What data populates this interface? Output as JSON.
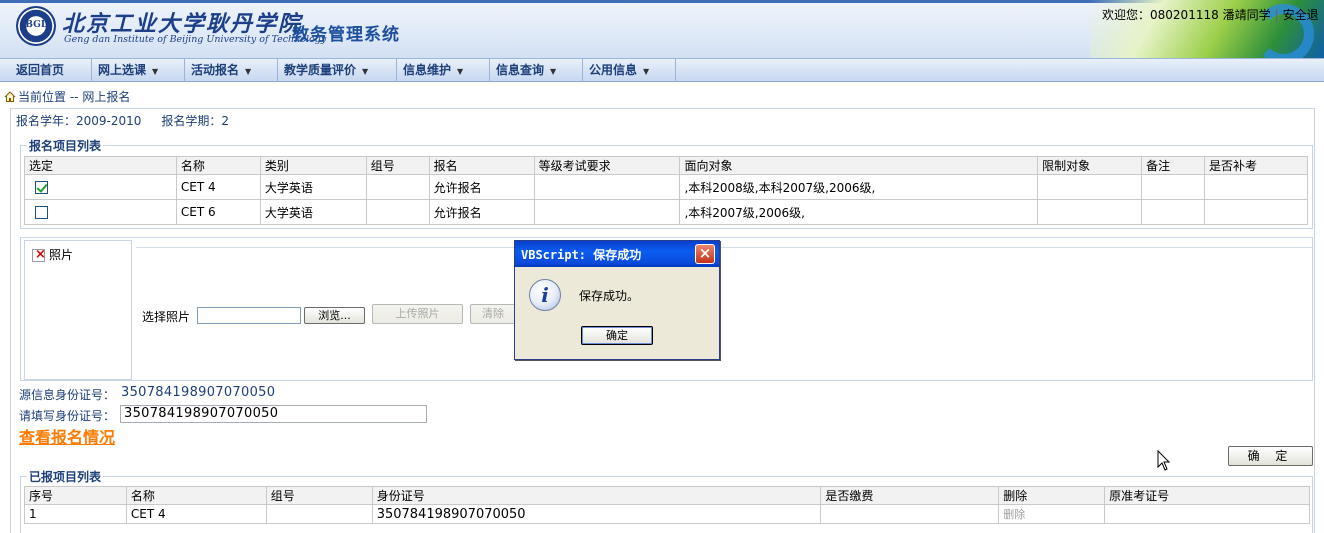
{
  "header": {
    "emblem_text": "BGD",
    "school_name_cn": "北京工业大学耿丹学院",
    "school_name_en": "Geng dan Institute of Beijing University of Technology",
    "system_title": "教务管理系统",
    "welcome_prefix": "欢迎您：",
    "user_id": "080201118",
    "user_name": "潘靖同学",
    "safe_exit": "安全退"
  },
  "nav": {
    "items": [
      {
        "label": "返回首页",
        "has_menu": false
      },
      {
        "label": "网上选课",
        "has_menu": true
      },
      {
        "label": "活动报名",
        "has_menu": true
      },
      {
        "label": "教学质量评价",
        "has_menu": true
      },
      {
        "label": "信息维护",
        "has_menu": true
      },
      {
        "label": "信息查询",
        "has_menu": true
      },
      {
        "label": "公用信息",
        "has_menu": true
      }
    ]
  },
  "breadcrumb": {
    "prefix": "当前位置",
    "path": "-- 网上报名"
  },
  "term": {
    "year": "报名学年：2009-2010",
    "semester": "报名学期：2"
  },
  "project_list": {
    "legend": "报名项目列表",
    "columns": [
      "选定",
      "名称",
      "类别",
      "组号",
      "报名",
      "等级考试要求",
      "面向对象",
      "限制对象",
      "备注",
      "是否补考"
    ],
    "rows": [
      {
        "selected": true,
        "name": "CET 4",
        "category": "大学英语",
        "group": "",
        "signup": "允许报名",
        "requirement": "",
        "target": ",本科2008级,本科2007级,2006级,",
        "restrict": "",
        "note": "",
        "makeup": ""
      },
      {
        "selected": false,
        "name": "CET 6",
        "category": "大学英语",
        "group": "",
        "signup": "允许报名",
        "requirement": "",
        "target": ",本科2007级,2006级,",
        "restrict": "",
        "note": "",
        "makeup": ""
      }
    ]
  },
  "photo": {
    "placeholder_alt": "照片",
    "choose_label": "选择照片",
    "browse_label": "浏览...",
    "upload_label": "上传照片",
    "clear_label": "清除"
  },
  "identity": {
    "source_label": "源信息身份证号：",
    "source_value": "350784198907070050",
    "fill_label": "请填写身份证号：",
    "fill_value": "350784198907070050",
    "view_link": "查看报名情况",
    "confirm_label": "确 定"
  },
  "submitted_list": {
    "legend": "已报项目列表",
    "columns": [
      "序号",
      "名称",
      "组号",
      "身份证号",
      "是否缴费",
      "删除",
      "原准考证号"
    ],
    "rows": [
      {
        "index": "1",
        "name": "CET 4",
        "group": "",
        "id": "350784198907070050",
        "paid": "",
        "delete": "删除",
        "old_ticket": ""
      }
    ]
  },
  "dialog": {
    "title": "VBScript: 保存成功",
    "close_glyph": "×",
    "message": "保存成功。",
    "ok_label": "确定",
    "icon": "info-icon"
  },
  "colors": {
    "accent": "#1d3f7a",
    "link_orange": "#ff7a00",
    "titlebar_blue": "#0b5cf0"
  }
}
